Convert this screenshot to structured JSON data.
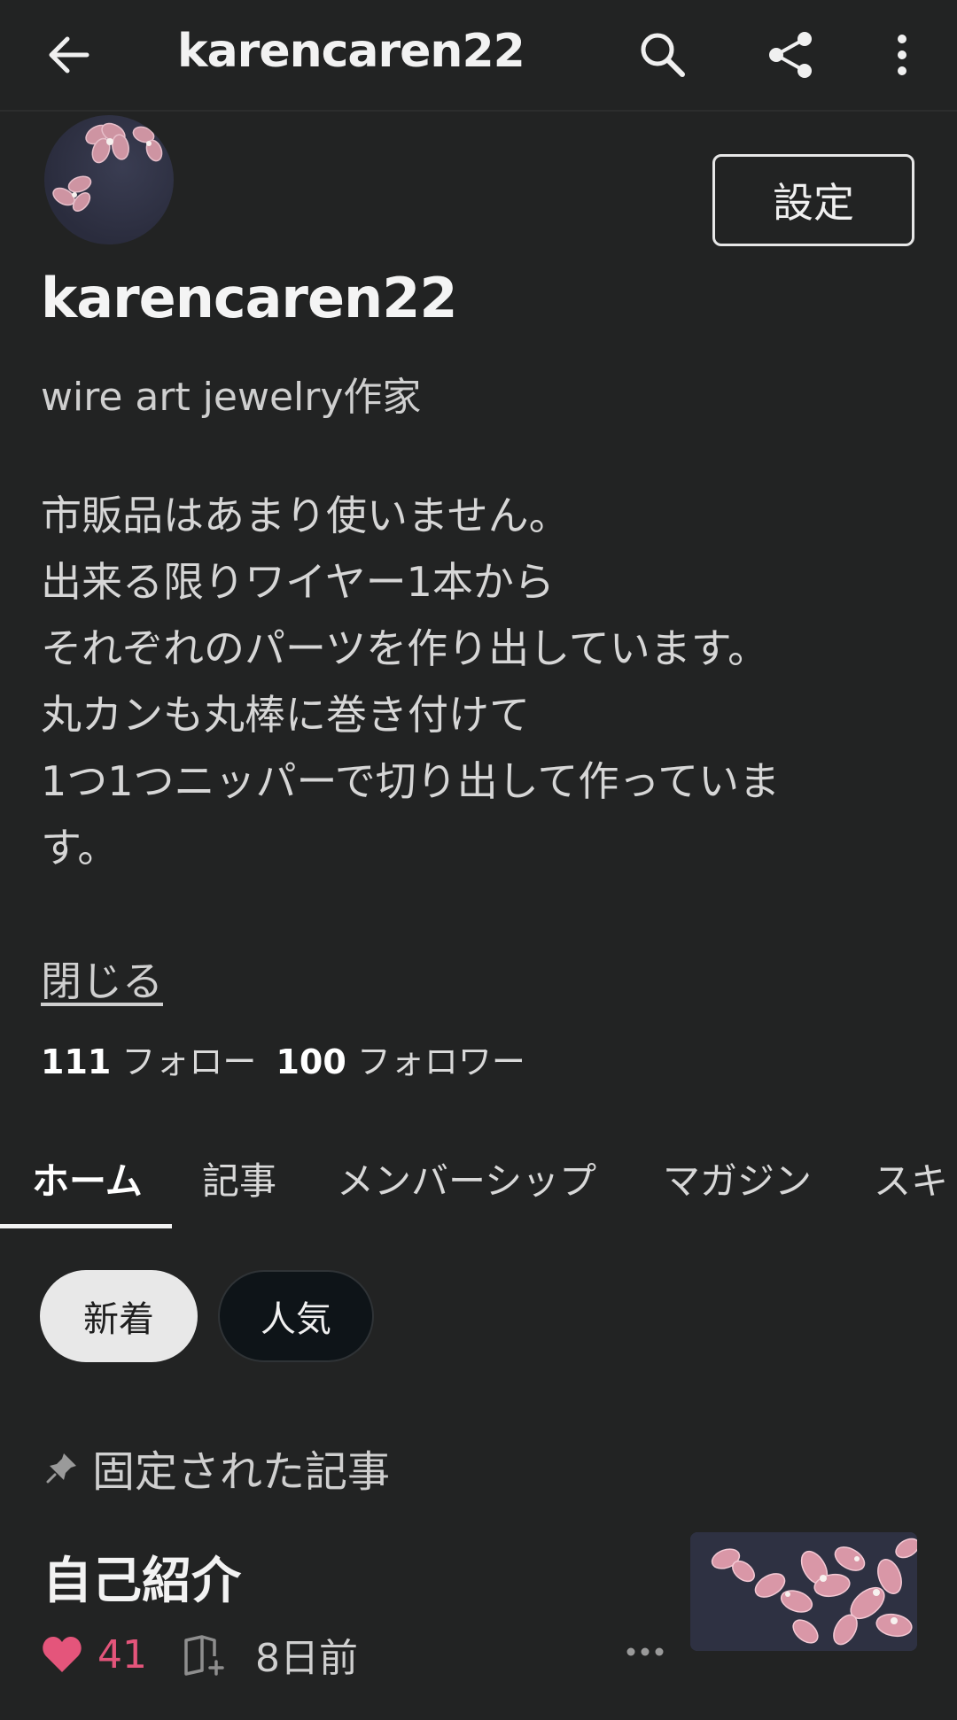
{
  "header": {
    "title": "karencaren22",
    "icons": [
      "back-arrow-icon",
      "search-icon",
      "share-icon",
      "more-vertical-icon"
    ]
  },
  "profile": {
    "name": "karencaren22",
    "settings_label": "設定",
    "tagline": "wire art jewelry作家",
    "bio_lines": [
      "市販品はあまり使いません。",
      "出来る限りワイヤー1本から",
      "それぞれのパーツを作り出しています。",
      "丸カンも丸棒に巻き付けて",
      "1つ1つニッパーで切り出して作っていま",
      "す。"
    ],
    "close_label": "閉じる",
    "following_count": "111",
    "following_label": "フォロー",
    "followers_count": "100",
    "followers_label": "フォロワー"
  },
  "tabs": [
    {
      "label": "ホーム",
      "active": true
    },
    {
      "label": "記事",
      "active": false
    },
    {
      "label": "メンバーシップ",
      "active": false
    },
    {
      "label": "マガジン",
      "active": false
    },
    {
      "label": "スキ",
      "active": false
    }
  ],
  "sort_chips": [
    {
      "label": "新着",
      "selected": true
    },
    {
      "label": "人気",
      "selected": false
    }
  ],
  "pinned": {
    "section_label": "固定された記事",
    "article": {
      "title": "自己紹介",
      "likes": "41",
      "posted": "8日前"
    }
  },
  "colors": {
    "background": "#222323",
    "like_pink": "#e4557b",
    "chip_selected": "#e8e8e8",
    "chip_dark": "#0e1418"
  }
}
